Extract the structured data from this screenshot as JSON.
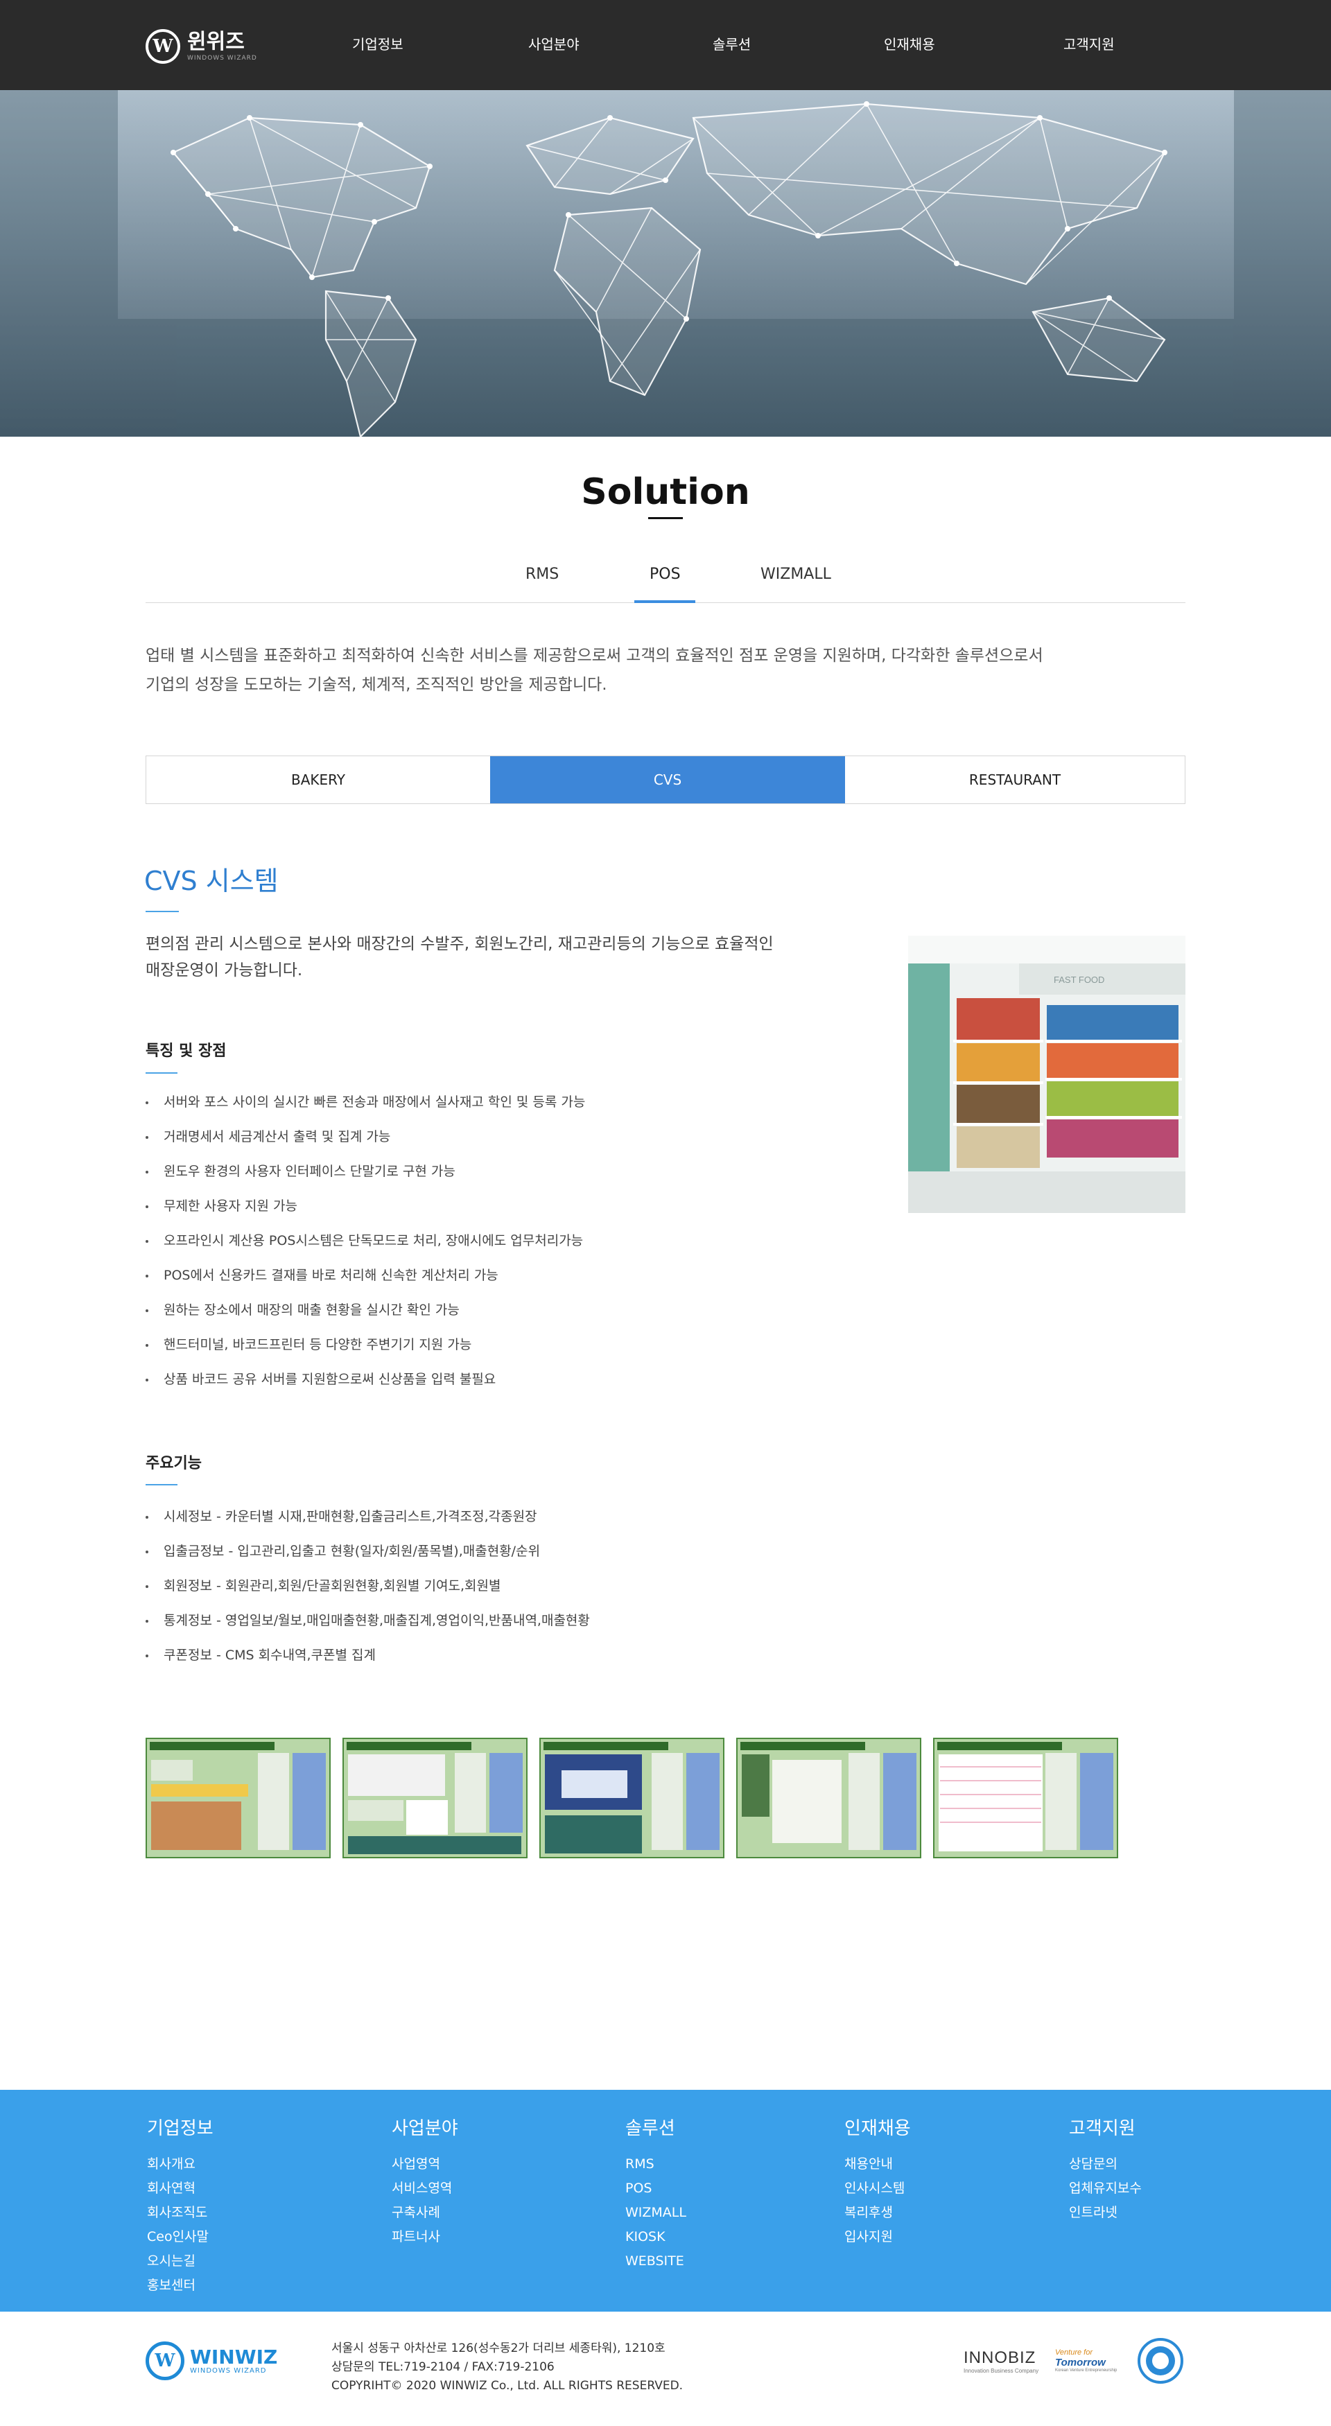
{
  "header": {
    "logo_text": "윈위즈",
    "logo_sub": "WINDOWS WIZARD",
    "logo_mark": "W",
    "nav": [
      "기업정보",
      "사업분야",
      "솔루션",
      "인재채용",
      "고객지원"
    ]
  },
  "page": {
    "title": "Solution",
    "tabs": [
      "RMS",
      "POS",
      "WIZMALL"
    ],
    "active_tab": "POS",
    "intro_line1": "업태 별 시스템을 표준화하고 최적화하여 신속한 서비스를 제공함으로써 고객의 효율적인 점포 운영을 지원하며, 다각화한 솔루션으로서",
    "intro_line2": "기업의 성장을 도모하는 기술적, 체계적, 조직적인 방안을 제공합니다.",
    "sub_tabs": [
      "BAKERY",
      "CVS",
      "RESTAURANT"
    ],
    "active_sub_tab": "CVS"
  },
  "cvs": {
    "title": "CVS 시스템",
    "desc_line1": "편의점 관리 시스템으로 본사와 매장간의 수발주, 회원노간리, 재고관리등의 기능으로 효율적인",
    "desc_line2": "매장운영이 가능합니다.",
    "image_sign": "FAST FOOD",
    "features_title": "특징 및 장점",
    "features": [
      "서버와 포스 사이의 실시간 빠른 전송과 매장에서 실사재고 학인 및 등록 가능",
      "거래명세서 세금계산서 출력 및 집계 가능",
      "윈도우 환경의 사용자 인터페이스 단말기로 구현 가능",
      "무제한 사용자 지원 가능",
      "오프라인시 계산용 POS시스템은 단독모드로 처리, 장애시에도 업무처리가능",
      "POS에서 신용카드 결재를 바로 처리해 신속한 계산처리 가능",
      "원하는 장소에서 매장의 매출 현황을 실시간 확인 가능",
      "핸드터미널, 바코드프린터 등 다양한 주변기기 지원 가능",
      "상품 바코드 공유 서버를 지원함으로써 신상품을 입력 불필요"
    ],
    "functions_title": "주요기능",
    "functions": [
      "시세정보 - 카운터별 시재,판매현황,입출금리스트,가격조정,각종원장",
      "입출금정보 - 입고관리,입출고 현황(일자/회원/품목별),매출현황/순위",
      "회원정보 - 회원관리,회원/단골회원현황,회원별 기여도,회원별",
      "통계정보 - 영업일보/월보,매입매출현황,매출집계,영업이익,반품내역,매출현황",
      "쿠폰정보 - CMS 회수내역,쿠폰별 집계"
    ],
    "screenshot_count": 5
  },
  "footer": {
    "columns": [
      {
        "title": "기업정보",
        "links": [
          "회사개요",
          "회사연혁",
          "회사조직도",
          "Ceo인사말",
          "오시는길",
          "홍보센터"
        ]
      },
      {
        "title": "사업분야",
        "links": [
          "사업영역",
          "서비스영역",
          "구축사례",
          "파트너사"
        ]
      },
      {
        "title": "솔루션",
        "links": [
          "RMS",
          "POS",
          "WIZMALL",
          "KIOSK",
          "WEBSITE"
        ]
      },
      {
        "title": "인재채용",
        "links": [
          "채용안내",
          "인사시스템",
          "복리후생",
          "입사지원"
        ]
      },
      {
        "title": "고객지원",
        "links": [
          "상담문의",
          "업체유지보수",
          "인트라넷"
        ]
      }
    ],
    "logo_text": "WINWIZ",
    "logo_sub": "WINDOWS WIZARD",
    "logo_mark": "W",
    "address": "서울시 성동구 아차산로 126(성수동2가 더리브 세종타워), 1210호",
    "contact": "상담문의 TEL:719-2104 / FAX:719-2106",
    "copyright": "COPYRIHT© 2020 WINWIZ Co., Ltd. ALL RIGHTS RESERVED.",
    "cert_innobiz": "INNOBIZ",
    "cert_innobiz_sub": "Innovation Business Company",
    "cert_venture": "Venture for",
    "cert_venture_main": "Tomorrow",
    "cert_venture_sub": "Korean Venture Entrepreneurship"
  },
  "colors": {
    "header_bg": "#2b2b2b",
    "accent": "#3d86d8",
    "footer_bg": "#3aa0ea",
    "cvs_title": "#2f7fd0"
  }
}
